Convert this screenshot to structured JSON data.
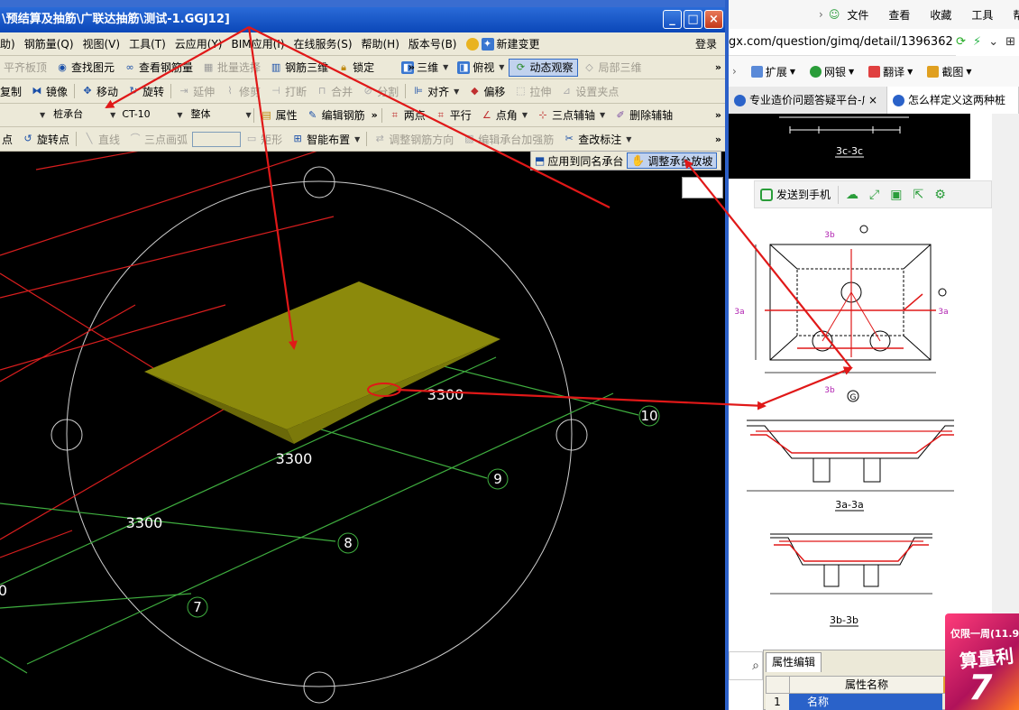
{
  "app": {
    "title": "\\预结算及抽筋\\广联达抽筋\\测试-1.GGJ12]",
    "window_buttons": [
      "_",
      "□",
      "×"
    ],
    "menu": [
      "钢筋量(Q)",
      "视图(V)",
      "工具(T)",
      "云应用(Y)",
      "BIM应用(I)",
      "在线服务(S)",
      "帮助(H)",
      "版本号(B)"
    ],
    "menu_partial_left": "助)",
    "menu_new_change": "新建变更",
    "menu_login": "登录",
    "toolbar1": [
      "平齐板顶",
      "查找图元",
      "查看钢筋量",
      "批量选择",
      "钢筋三维",
      "锁定",
      "三维",
      "俯视",
      "动态观察",
      "局部三维"
    ],
    "toolbar2": [
      "复制",
      "镜像",
      "移动",
      "旋转",
      "延伸",
      "修剪",
      "打断",
      "合并",
      "分割",
      "对齐",
      "偏移",
      "拉伸",
      "设置夹点"
    ],
    "toolbar3": {
      "select1": "",
      "select2": "桩承台",
      "select3": "CT-10",
      "select4": "整体",
      "items": [
        "属性",
        "编辑钢筋",
        "两点",
        "平行",
        "点角",
        "三点辅轴",
        "删除辅轴"
      ]
    },
    "toolbar4": [
      "点",
      "旋转点",
      "直线",
      "三点画弧",
      "矩形",
      "智能布置",
      "调整钢筋方向",
      "编辑承台加强筋",
      "查改标注"
    ],
    "floating_toolbar": [
      "应用到同名承台",
      "调整承台放坡"
    ],
    "more_glyph": "»"
  },
  "cad": {
    "dim_labels": [
      "3300",
      "3300",
      "3300",
      "0"
    ],
    "axis_labels": [
      "10",
      "9",
      "8",
      "7"
    ],
    "colors": {
      "background": "#000000",
      "grid_red": "#d81e1e",
      "grid_green": "#3fae3f",
      "pile_cap": "#8c8a0c",
      "circle": "#cfcfcf",
      "annotation_arrow": "#e01818"
    }
  },
  "browser": {
    "menu": [
      "文件",
      "查看",
      "收藏",
      "工具",
      "帮助"
    ],
    "address": "gx.com/question/gimq/detail/1396362",
    "tools": [
      "扩展",
      "网银",
      "翻译",
      "截图"
    ],
    "tabs": [
      "专业造价问题答疑平台-广",
      "怎么样定义这两种桩"
    ],
    "share_bar": {
      "send_to_phone": "发送到手机"
    },
    "drawing_labels": {
      "section_top": "3c-3c",
      "section_mid": "3a-3a",
      "section_bot": "3b-3b",
      "circle_g": "G",
      "mark_3b_top": "3b",
      "mark_3b_bot": "3b",
      "mark_3a_left": "3a",
      "mark_3a_right": "3a"
    },
    "property_editor": {
      "tab": "属性编辑",
      "header": "属性名称",
      "row_index": "1",
      "row_name": "名称"
    },
    "ad": {
      "line1": "仅限一周(11.9",
      "line2": "算量利",
      "line3": "7"
    }
  }
}
